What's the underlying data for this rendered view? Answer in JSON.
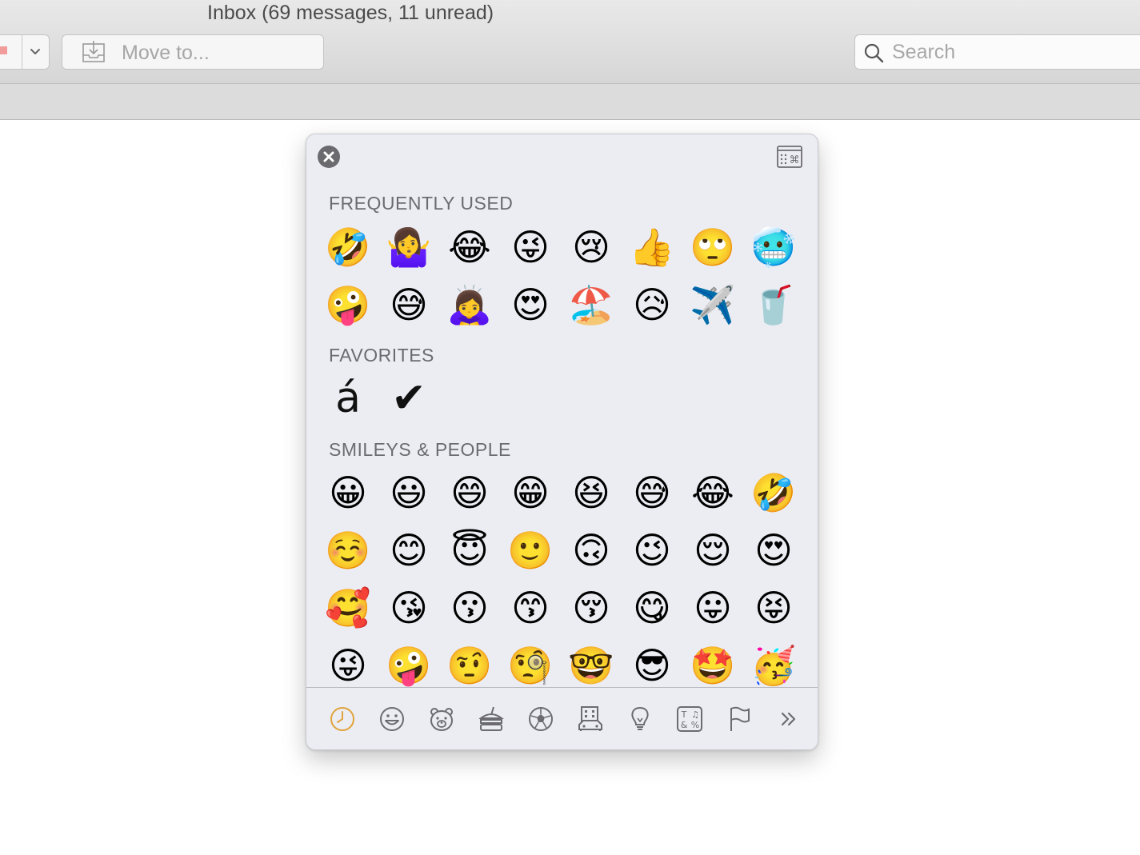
{
  "window": {
    "title": "Inbox (69 messages, 11 unread)"
  },
  "toolbar": {
    "move_to_label": "Move to...",
    "search_placeholder": "Search"
  },
  "emoji_panel": {
    "sections": {
      "frequently_used": {
        "title": "FREQUENTLY USED",
        "emojis": [
          "🤣",
          "🤷‍♀️",
          "😂",
          "😜",
          "😢",
          "👍",
          "🙄",
          "🥶",
          "🤪",
          "😅",
          "🙇‍♀️",
          "😍",
          "🏖️",
          "😥",
          "✈️",
          "🥤"
        ]
      },
      "favorites": {
        "title": "FAVORITES",
        "items": [
          "á",
          "✔"
        ]
      },
      "smileys_people": {
        "title": "SMILEYS & PEOPLE",
        "emojis": [
          "😀",
          "😃",
          "😄",
          "😁",
          "😆",
          "😅",
          "😂",
          "🤣",
          "☺️",
          "😊",
          "😇",
          "🙂",
          "🙃",
          "😉",
          "😌",
          "😍",
          "🥰",
          "😘",
          "😗",
          "😙",
          "😚",
          "😋",
          "😛",
          "😝",
          "😜",
          "🤪",
          "🤨",
          "🧐",
          "🤓",
          "😎",
          "🤩",
          "🥳"
        ]
      }
    },
    "categories": [
      {
        "name": "recent",
        "icon": "clock-icon",
        "active": true
      },
      {
        "name": "smileys",
        "icon": "smiley-icon"
      },
      {
        "name": "animals",
        "icon": "bear-icon"
      },
      {
        "name": "food",
        "icon": "burger-icon"
      },
      {
        "name": "activity",
        "icon": "soccer-ball-icon"
      },
      {
        "name": "travel",
        "icon": "building-car-icon"
      },
      {
        "name": "objects",
        "icon": "lightbulb-icon"
      },
      {
        "name": "symbols",
        "icon": "symbols-icon"
      },
      {
        "name": "flags",
        "icon": "flag-icon"
      },
      {
        "name": "more",
        "icon": "double-chevron-icon"
      }
    ],
    "accent_color": "#e0a33a",
    "icon_color": "#6b6b70"
  }
}
